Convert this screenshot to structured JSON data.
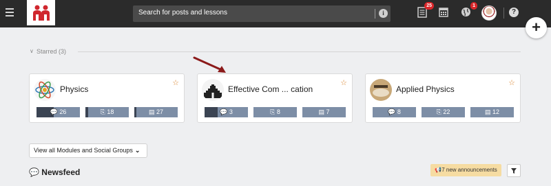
{
  "header": {
    "search_placeholder": "Search for posts and lessons",
    "notifications_count": "25",
    "globe_count": "1"
  },
  "starred": {
    "label": "Starred (3)",
    "cards": [
      {
        "title": "Physics",
        "stats": [
          "26",
          "18",
          "27"
        ],
        "icon_set": [
          "comments-icon",
          "book-icon",
          "newspaper-icon"
        ]
      },
      {
        "title": "Effective Com ... cation",
        "stats": [
          "3",
          "8",
          "7"
        ],
        "icon_set": [
          "comments-icon",
          "book-icon",
          "newspaper-icon"
        ]
      },
      {
        "title": "Applied Physics",
        "stats": [
          "8",
          "22",
          "12"
        ],
        "icon_set": [
          "comments-icon",
          "book-icon",
          "newspaper-icon"
        ]
      }
    ]
  },
  "view_all_label": "View all Modules and Social Groups",
  "newsfeed": {
    "title": "Newsfeed",
    "announcements": "7 new announcements"
  },
  "colors": {
    "topbar": "#2b2b2b",
    "stat_bar": "#7d8ea6",
    "stat_fill": "#3b4453",
    "star": "#d9822b",
    "badge": "#d9262a",
    "arrow": "#8b1a1a",
    "announce_bg": "#f6dca2"
  }
}
